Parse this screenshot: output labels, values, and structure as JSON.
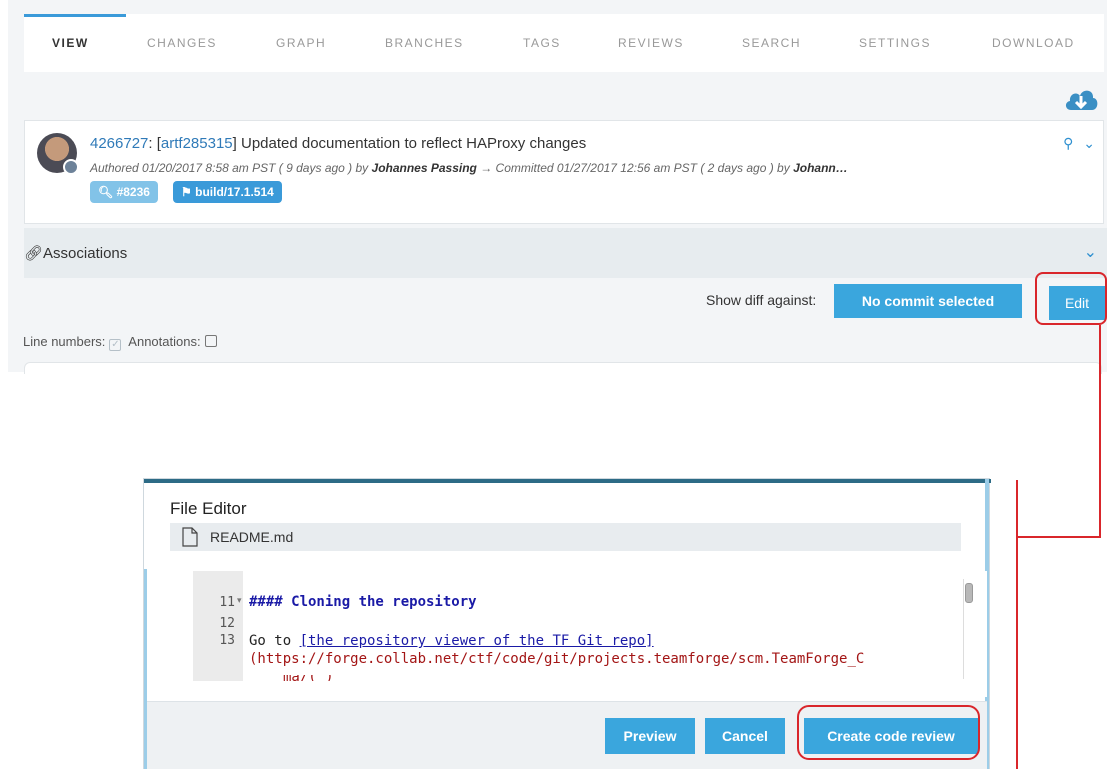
{
  "tabs": [
    {
      "label": "VIEW",
      "active": true
    },
    {
      "label": "CHANGES"
    },
    {
      "label": "GRAPH"
    },
    {
      "label": "BRANCHES"
    },
    {
      "label": "TAGS"
    },
    {
      "label": "REVIEWS"
    },
    {
      "label": "SEARCH"
    },
    {
      "label": "SETTINGS"
    },
    {
      "label": "DOWNLOAD"
    }
  ],
  "commit": {
    "hash": "4266727",
    "artifact": "artf285315",
    "message": "] Updated documentation to reflect HAProxy changes",
    "meta_authored": "Authored 01/20/2017 8:58 am PST ( 9 days ago ) by ",
    "author": "Johannes Passing",
    "meta_committed": " → Committed 01/27/2017 12:56 am PST ( 2 days ago ) by ",
    "committer": "Johann…",
    "review_pill": "#8236",
    "tag_pill": "build/17.1.514"
  },
  "associations": {
    "label": "Associations"
  },
  "diff": {
    "label": "Show diff against:",
    "selector": "No commit selected",
    "edit_label": "Edit"
  },
  "options": {
    "line_numbers": "Line numbers:",
    "annotations": "Annotations:"
  },
  "editor": {
    "title": "File Editor",
    "filename": "README.md",
    "lines": [
      {
        "num": "11",
        "text": "#### Cloning the repository"
      },
      {
        "num": "12",
        "text": ""
      },
      {
        "num": "13",
        "text_prefix": "Go to ",
        "link_text": "[the repository viewer of the TF Git repo]"
      }
    ],
    "url_line": "(https://forge.collab.net/ctf/code/git/projects.teamforge/scm.TeamForge_C",
    "buttons": {
      "preview": "Preview",
      "cancel": "Cancel",
      "create_review": "Create code review"
    }
  },
  "colors": {
    "accent": "#3aa6dd",
    "link": "#2f7ab8",
    "highlight": "#d9262b",
    "heading_code": "#1a1aa6",
    "url_code": "#a31515"
  }
}
